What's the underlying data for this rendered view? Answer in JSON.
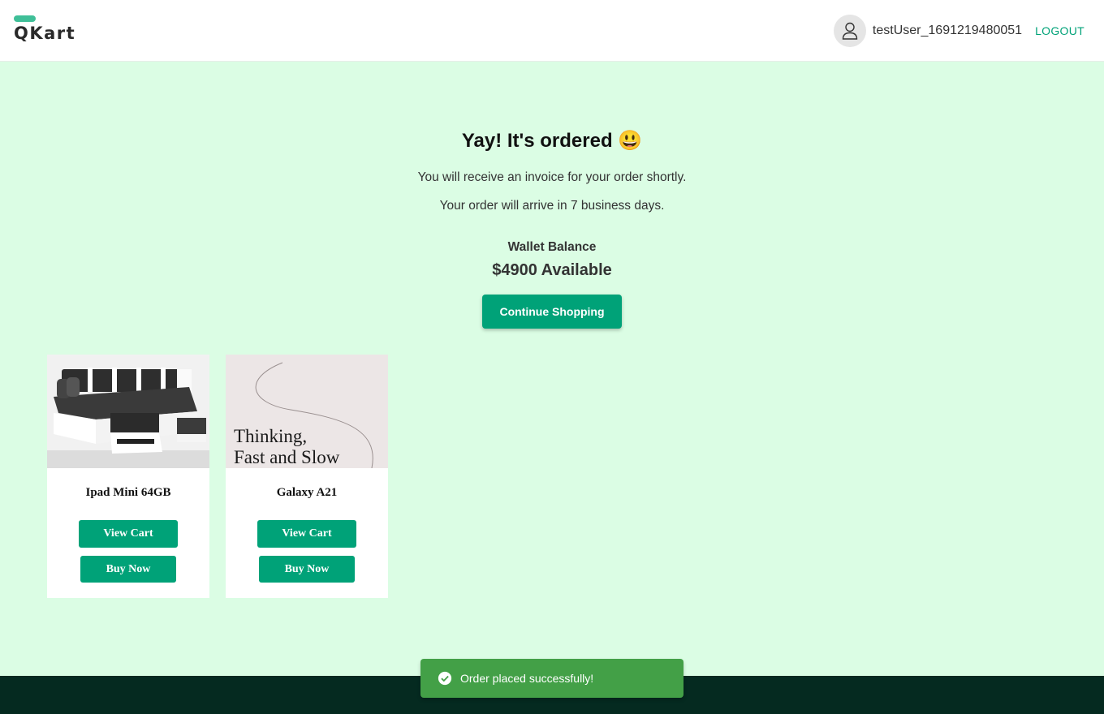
{
  "header": {
    "logo_text": "QKart",
    "username": "testUser_1691219480051",
    "logout_label": "LOGOUT",
    "avatar_icon": "user-icon"
  },
  "thanks": {
    "title": "Yay! It's ordered 😃",
    "invoice_message": "You will receive an invoice for your order shortly.",
    "delivery_message": "Your order will arrive in 7 business days.",
    "wallet_label": "Wallet Balance",
    "wallet_amount": "$4900 Available",
    "continue_label": "Continue Shopping"
  },
  "products": [
    {
      "name": "Ipad Mini 64GB",
      "view_cart_label": "View Cart",
      "buy_now_label": "Buy Now",
      "image": "sofa-set-image"
    },
    {
      "name": "Galaxy A21",
      "view_cart_label": "View Cart",
      "buy_now_label": "Buy Now",
      "image": "book-cover-image",
      "image_text_line1": "Thinking,",
      "image_text_line2": "Fast and Slow"
    }
  ],
  "toast": {
    "message": "Order placed successfully!",
    "icon": "check-circle-icon"
  },
  "colors": {
    "accent": "#00a278",
    "page_background": "#dbfde4",
    "footer": "#052a20",
    "toast": "#43a047"
  }
}
